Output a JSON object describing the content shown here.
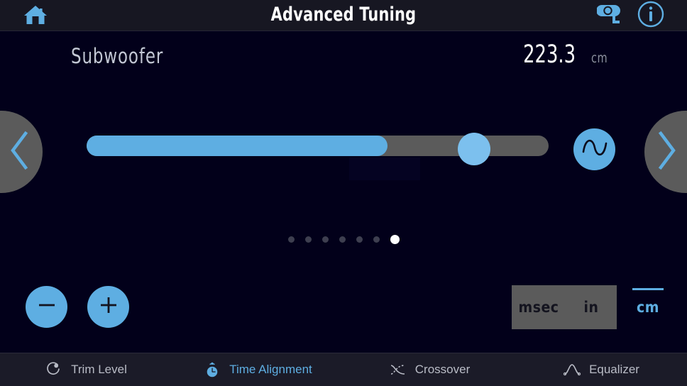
{
  "header": {
    "title": "Advanced Tuning",
    "home_icon": "home-icon",
    "tape_measure_icon": "tape-measure-icon",
    "info_icon": "info-icon"
  },
  "channel": {
    "name": "Subwoofer",
    "prev_icon": "chevron-left-icon",
    "next_icon": "chevron-right-icon"
  },
  "reading": {
    "value": "223.3",
    "unit": "cm"
  },
  "slider": {
    "fill_percent": 65,
    "phase_icon": "sine-wave-icon"
  },
  "pager": {
    "total": 7,
    "active_index": 6
  },
  "stepper": {
    "decrement_label": "−",
    "increment_label": "+"
  },
  "units": {
    "options": [
      {
        "label": "msec",
        "selected": false
      },
      {
        "label": "in",
        "selected": false
      },
      {
        "label": "cm",
        "selected": true
      }
    ]
  },
  "bottom_nav": {
    "items": [
      {
        "label": "Trim Level",
        "icon": "knob-icon",
        "active": false
      },
      {
        "label": "Time Alignment",
        "icon": "stopwatch-icon",
        "active": true
      },
      {
        "label": "Crossover",
        "icon": "crossover-curve-icon",
        "active": false
      },
      {
        "label": "Equalizer",
        "icon": "eq-curve-icon",
        "active": false
      }
    ]
  },
  "colors": {
    "accent": "#5eaee2",
    "thumb": "#7cc0ee",
    "background": "#02001a",
    "header_bg": "#171722",
    "nav_bg": "#1b1b28",
    "gray_control": "#5b5b5b"
  }
}
